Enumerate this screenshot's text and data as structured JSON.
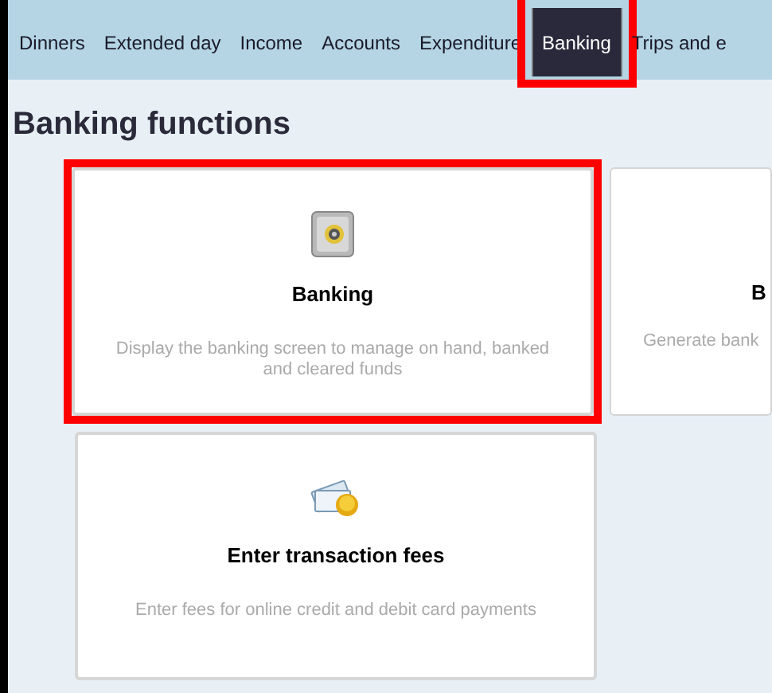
{
  "tabs": [
    {
      "label": "Dinners",
      "selected": false,
      "highlighted": false
    },
    {
      "label": "Extended day",
      "selected": false,
      "highlighted": false
    },
    {
      "label": "Income",
      "selected": false,
      "highlighted": false
    },
    {
      "label": "Accounts",
      "selected": false,
      "highlighted": false
    },
    {
      "label": "Expenditure",
      "selected": false,
      "highlighted": false
    },
    {
      "label": "Banking",
      "selected": true,
      "highlighted": true
    },
    {
      "label": "Trips and e",
      "selected": false,
      "highlighted": false
    }
  ],
  "heading": "Banking functions",
  "cards": [
    {
      "kind": "safe",
      "title": "Banking",
      "description": "Display the banking screen to manage on hand, banked and cleared funds",
      "highlighted": true
    },
    {
      "kind": "cut",
      "title": "B",
      "description": "Generate bank"
    },
    {
      "kind": "fees",
      "title": "Enter transaction fees",
      "description": "Enter fees for online credit and debit card payments",
      "highlighted": false
    }
  ]
}
